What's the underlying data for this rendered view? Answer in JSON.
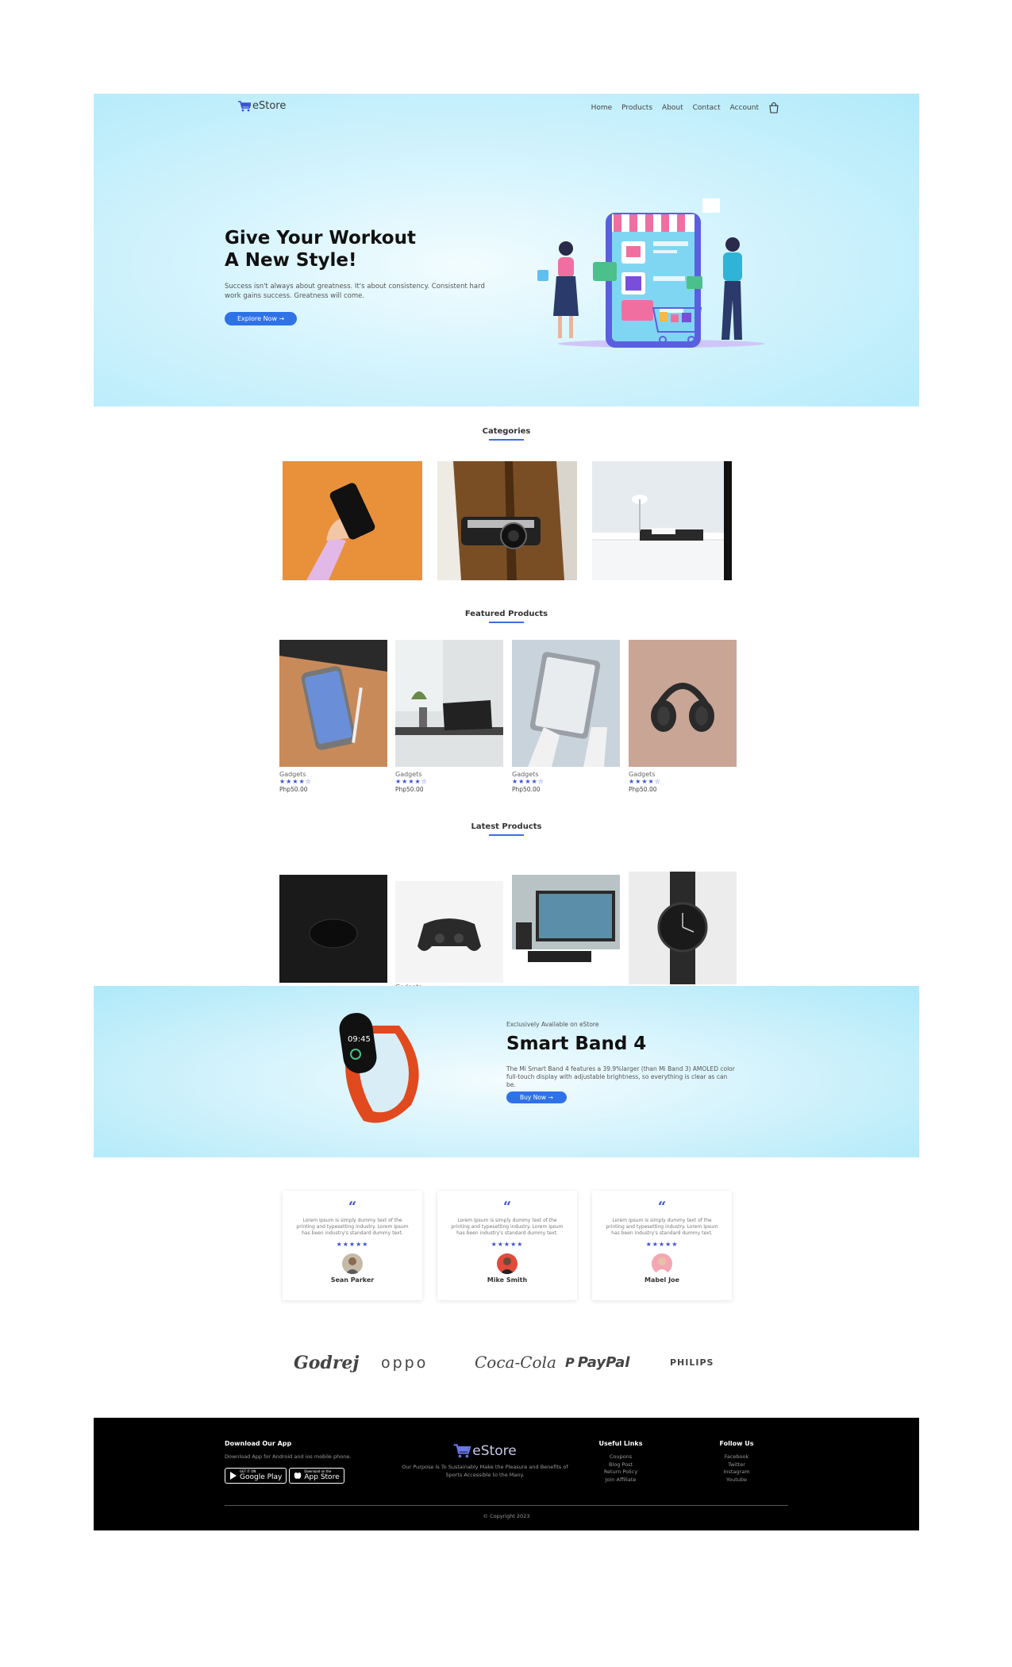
{
  "nav": {
    "logo_text": "eStore",
    "links": [
      "Home",
      "Products",
      "About",
      "Contact",
      "Account"
    ]
  },
  "hero": {
    "title_line1": "Give Your Workout",
    "title_line2": "A New Style!",
    "subtitle": "Success isn't always about greatness. It's about consistency. Consistent hard work gains success. Greatness will come.",
    "button": "Explore Now →"
  },
  "categories": {
    "title": "Categories"
  },
  "featured": {
    "title": "Featured Products",
    "items": [
      {
        "category": "Gadgets",
        "rating": 4,
        "price": "Php50.00"
      },
      {
        "category": "Gadgets",
        "rating": 4,
        "price": "Php50.00"
      },
      {
        "category": "Gadgets",
        "rating": 4,
        "price": "Php50.00"
      },
      {
        "category": "Gadgets",
        "rating": 4,
        "price": "Php50.00"
      }
    ]
  },
  "latest": {
    "title": "Latest Products",
    "items": [
      {
        "category": ""
      },
      {
        "category": "Gadgets"
      },
      {
        "category": ""
      },
      {
        "category": ""
      }
    ]
  },
  "promo": {
    "tag": "Exclusively Available on eStore",
    "title": "Smart Band 4",
    "description": "The Mi Smart Band 4 features a 39.9%larger (than Mi Band 3) AMOLED color full-touch display with adjustable brightness, so everything is clear as can be.",
    "button": "Buy Now →",
    "watch_time": "09:45"
  },
  "testimonials": [
    {
      "text": "Lorem Ipsum is simply dummy text of the printing and typesetting industry. Lorem Ipsum has been industry's standard dummy text.",
      "rating": 5,
      "name": "Sean Parker"
    },
    {
      "text": "Lorem Ipsum is simply dummy text of the printing and typesetting industry. Lorem Ipsum has been industry's standard dummy text.",
      "rating": 5,
      "name": "Mike Smith"
    },
    {
      "text": "Lorem Ipsum is simply dummy text of the printing and typesetting industry. Lorem Ipsum has been industry's standard dummy text.",
      "rating": 5,
      "name": "Mabel Joe"
    }
  ],
  "brands": [
    "Godrej",
    "oppo",
    "Coca-Cola",
    "PayPal",
    "PHILIPS"
  ],
  "footer": {
    "download_title": "Download Our App",
    "download_text": "Download App for Android and ios mobile phone.",
    "google_small": "GET IT ON",
    "google_big": "Google Play",
    "apple_small": "Download on the",
    "apple_big": "App Store",
    "logo_text": "eStore",
    "purpose": "Our Purpose Is To Sustainably Make the Pleasure and Benefits of Sports Accessible to the Many.",
    "useful_title": "Useful Links",
    "useful_links": [
      "Coupons",
      "Blog Post",
      "Return Policy",
      "Join Affiliate"
    ],
    "follow_title": "Follow Us",
    "follow_links": [
      "Facebook",
      "Twitter",
      "Instagram",
      "Youtube"
    ],
    "copyright": "© Copyright 2023"
  },
  "colors": {
    "accent": "#2f72e8",
    "star": "#3b4fd8",
    "hero_bg": "#b1eafa",
    "footer_bg": "#000000"
  }
}
